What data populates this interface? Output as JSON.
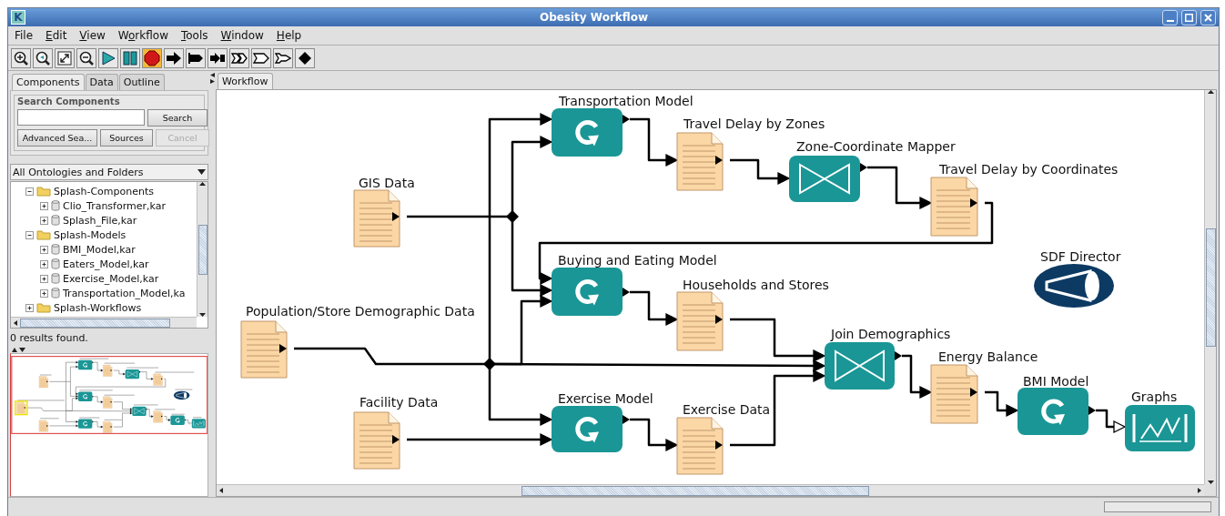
{
  "window": {
    "title": "Obesity Workflow",
    "icon_letter": "K"
  },
  "menu": [
    {
      "label": "File"
    },
    {
      "label": "Edit"
    },
    {
      "label": "View"
    },
    {
      "label": "Workflow"
    },
    {
      "label": "Tools"
    },
    {
      "label": "Window"
    },
    {
      "label": "Help"
    }
  ],
  "toolbar": [
    {
      "kind": "zoom-in",
      "selected": false
    },
    {
      "kind": "zoom-reset",
      "selected": false
    },
    {
      "kind": "zoom-fit",
      "selected": false
    },
    {
      "kind": "zoom-out",
      "selected": false
    },
    {
      "kind": "run",
      "selected": false
    },
    {
      "kind": "pause",
      "selected": false
    },
    {
      "kind": "stop",
      "selected": true
    },
    {
      "kind": "arrow",
      "selected": false
    },
    {
      "kind": "bar-arrow",
      "selected": false
    },
    {
      "kind": "short-arrow",
      "selected": false
    },
    {
      "kind": "double-outline",
      "selected": false
    },
    {
      "kind": "flag-outline",
      "selected": false
    },
    {
      "kind": "notched-outline",
      "selected": false
    },
    {
      "kind": "diamond",
      "selected": false
    }
  ],
  "left_tabs": [
    {
      "label": "Components",
      "selected": true
    },
    {
      "label": "Data",
      "selected": false
    },
    {
      "label": "Outline",
      "selected": false
    }
  ],
  "search": {
    "title": "Search Components",
    "buttons": [
      {
        "label": "Search",
        "disabled": false
      },
      {
        "label": "Advanced Sea...",
        "disabled": false
      },
      {
        "label": "Sources",
        "disabled": false
      },
      {
        "label": "Cancel",
        "disabled": true
      }
    ]
  },
  "library_dropdown": {
    "value": "All Ontologies and Folders"
  },
  "tree": [
    {
      "label": "Splash-Components",
      "kind": "folder",
      "expanded": true,
      "children": [
        {
          "label": "Clio_Transformer,kar",
          "kind": "archive",
          "expanded": false
        },
        {
          "label": "Splash_File,kar",
          "kind": "archive",
          "expanded": false
        }
      ]
    },
    {
      "label": "Splash-Models",
      "kind": "folder",
      "expanded": true,
      "children": [
        {
          "label": "BMI_Model,kar",
          "kind": "archive",
          "expanded": false
        },
        {
          "label": "Eaters_Model,kar",
          "kind": "archive",
          "expanded": false
        },
        {
          "label": "Exercise_Model,kar",
          "kind": "archive",
          "expanded": false
        },
        {
          "label": "Transportation_Model,ka",
          "kind": "archive",
          "expanded": false
        }
      ]
    },
    {
      "label": "Splash-Workflows",
      "kind": "folder",
      "expanded": false
    }
  ],
  "results_text": "0 results found.",
  "status_progress": {
    "level": 0
  },
  "canvas_tabs": [
    {
      "label": "Workflow",
      "selected": true
    }
  ],
  "workflow": {
    "nodes": [
      {
        "label": "Transportation Model",
        "kind": "actor"
      },
      {
        "label": "Travel Delay by Zones",
        "kind": "data"
      },
      {
        "label": "Zone-Coordinate Mapper",
        "kind": "join"
      },
      {
        "label": "Travel Delay by Coordinates",
        "kind": "data"
      },
      {
        "label": "GIS Data",
        "kind": "data"
      },
      {
        "label": "SDF Director",
        "kind": "director"
      },
      {
        "label": "Buying and Eating Model",
        "kind": "actor"
      },
      {
        "label": "Households and Stores",
        "kind": "data"
      },
      {
        "label": "Population/Store Demographic Data",
        "kind": "data"
      },
      {
        "label": "Join Demographics",
        "kind": "join"
      },
      {
        "label": "Energy Balance",
        "kind": "data"
      },
      {
        "label": "BMI Model",
        "kind": "actor"
      },
      {
        "label": "Graphs",
        "kind": "plot"
      },
      {
        "label": "Facility Data",
        "kind": "data"
      },
      {
        "label": "Exercise Model",
        "kind": "actor"
      },
      {
        "label": "Exercise Data",
        "kind": "data"
      }
    ]
  }
}
